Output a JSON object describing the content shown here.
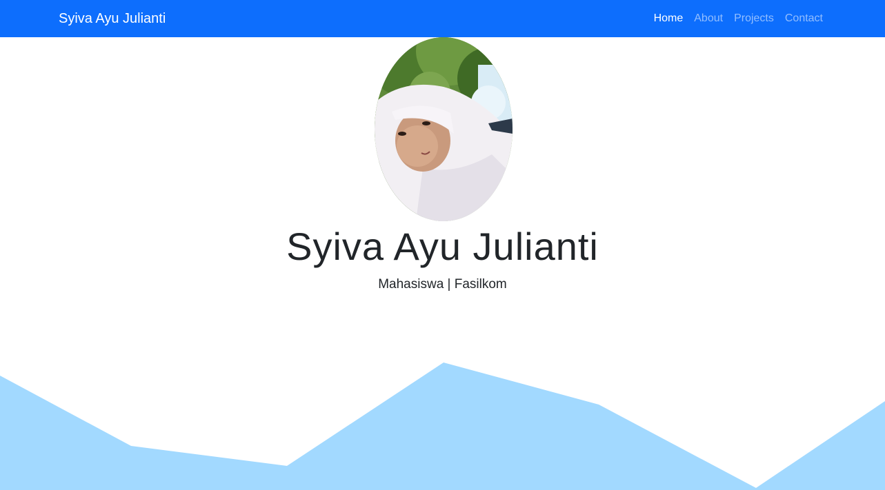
{
  "navbar": {
    "brand": "Syiva Ayu Julianti",
    "links": [
      {
        "label": "Home",
        "active": true
      },
      {
        "label": "About",
        "active": false
      },
      {
        "label": "Projects",
        "active": false
      },
      {
        "label": "Contact",
        "active": false
      }
    ]
  },
  "hero": {
    "name": "Syiva Ayu Julianti",
    "subtitle": "Mahasiswa | Fasilkom"
  },
  "colors": {
    "navbar_bg": "#0d6efd",
    "wave_fill": "#a2d9ff"
  }
}
